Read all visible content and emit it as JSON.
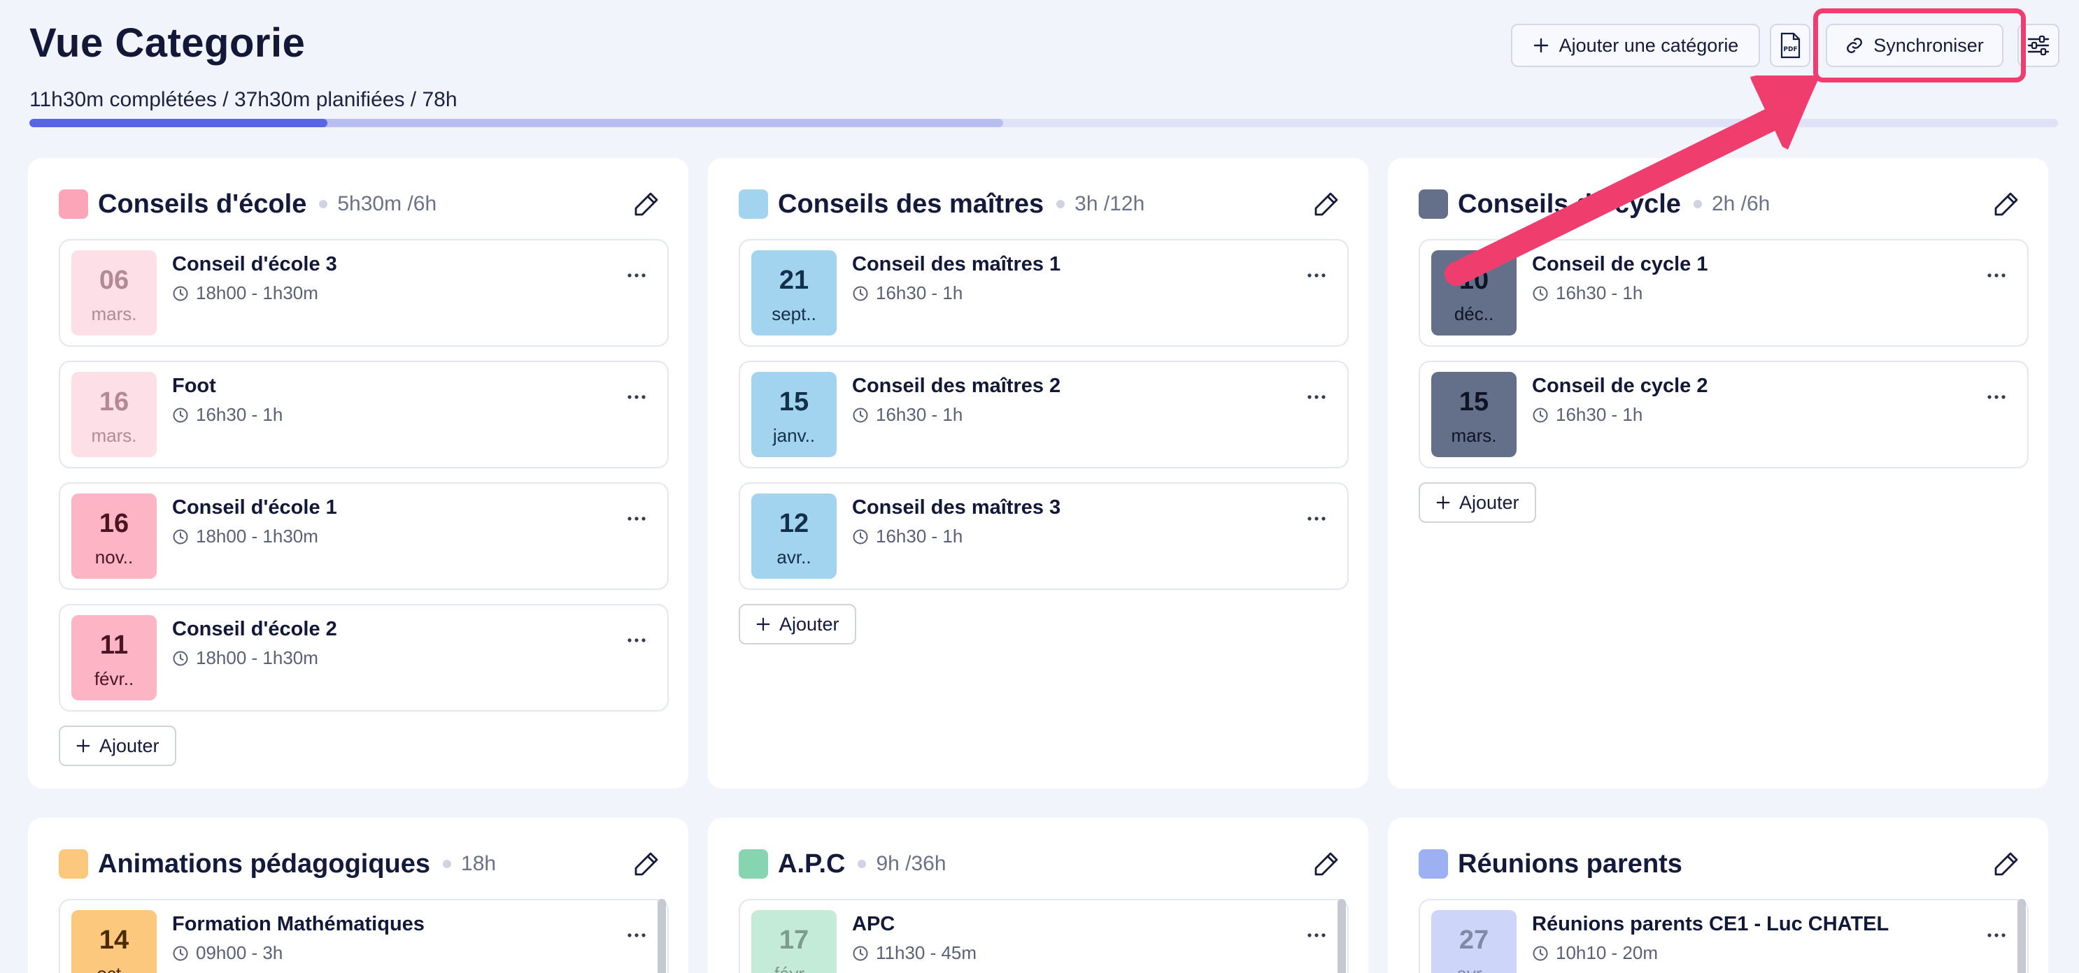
{
  "header": {
    "title": "Vue Categorie",
    "progress_text": "11h30m complétées / 37h30m planifiées / 78h",
    "progress_done": 0.147,
    "progress_planned": 0.48
  },
  "toolbar": {
    "add_category_label": "Ajouter une catégorie",
    "pdf_label": "PDF",
    "sync_label": "Synchroniser"
  },
  "common": {
    "add_label": "Ajouter"
  },
  "categories": [
    {
      "title": "Conseils d'école",
      "hours": "5h30m /6h",
      "color": "#fca5b8",
      "events": [
        {
          "day": "06",
          "month": "mars.",
          "title": "Conseil d'école 3",
          "time": "18h00 - 1h30m",
          "bg": "#fde0e7",
          "fg": "#b38a94",
          "faded": true
        },
        {
          "day": "16",
          "month": "mars.",
          "title": "Foot",
          "time": "16h30 - 1h",
          "bg": "#fde0e7",
          "fg": "#b38a94",
          "faded": true
        },
        {
          "day": "16",
          "month": "nov..",
          "title": "Conseil d'école 1",
          "time": "18h00 - 1h30m",
          "bg": "#fdb4c4",
          "fg": "#4a1420"
        },
        {
          "day": "11",
          "month": "févr..",
          "title": "Conseil d'école 2",
          "time": "18h00 - 1h30m",
          "bg": "#fdb4c4",
          "fg": "#4a1420"
        }
      ]
    },
    {
      "title": "Conseils des maîtres",
      "hours": "3h /12h",
      "color": "#a2d4ef",
      "events": [
        {
          "day": "21",
          "month": "sept..",
          "title": "Conseil des maîtres 1",
          "time": "16h30 - 1h",
          "bg": "#a2d4ef",
          "fg": "#12304a"
        },
        {
          "day": "15",
          "month": "janv..",
          "title": "Conseil des maîtres 2",
          "time": "16h30 - 1h",
          "bg": "#a2d4ef",
          "fg": "#12304a"
        },
        {
          "day": "12",
          "month": "avr..",
          "title": "Conseil des maîtres 3",
          "time": "16h30 - 1h",
          "bg": "#a2d4ef",
          "fg": "#12304a"
        }
      ]
    },
    {
      "title": "Conseils de cycle",
      "hours": "2h /6h",
      "color": "#64708a",
      "events": [
        {
          "day": "10",
          "month": "déc..",
          "title": "Conseil de cycle 1",
          "time": "16h30 - 1h",
          "bg": "#64708a",
          "fg": "#0e1426"
        },
        {
          "day": "15",
          "month": "mars.",
          "title": "Conseil de cycle 2",
          "time": "16h30 - 1h",
          "bg": "#64708a",
          "fg": "#0e1426"
        }
      ]
    },
    {
      "title": "Animations pédagogiques",
      "hours": "18h",
      "color": "#fcc87e",
      "events": [
        {
          "day": "14",
          "month": "oct..",
          "title": "Formation Mathématiques",
          "time": "09h00 - 3h",
          "bg": "#fcc87e",
          "fg": "#4a2a08"
        }
      ]
    },
    {
      "title": "A.P.C",
      "hours": "9h /36h",
      "color": "#86d4b0",
      "events": [
        {
          "day": "17",
          "month": "févr..",
          "title": "APC",
          "time": "11h30 - 45m",
          "bg": "#c4ebd8",
          "fg": "#7e9c8e",
          "faded": true
        }
      ]
    },
    {
      "title": "Réunions parents",
      "hours": "",
      "color": "#9cb0f2",
      "events": [
        {
          "day": "27",
          "month": "avr..",
          "title": "Réunions parents CE1 - Luc CHATEL",
          "time": "10h10 - 20m",
          "bg": "#cdd6f8",
          "fg": "#7f8aa8",
          "faded": true
        }
      ]
    }
  ]
}
